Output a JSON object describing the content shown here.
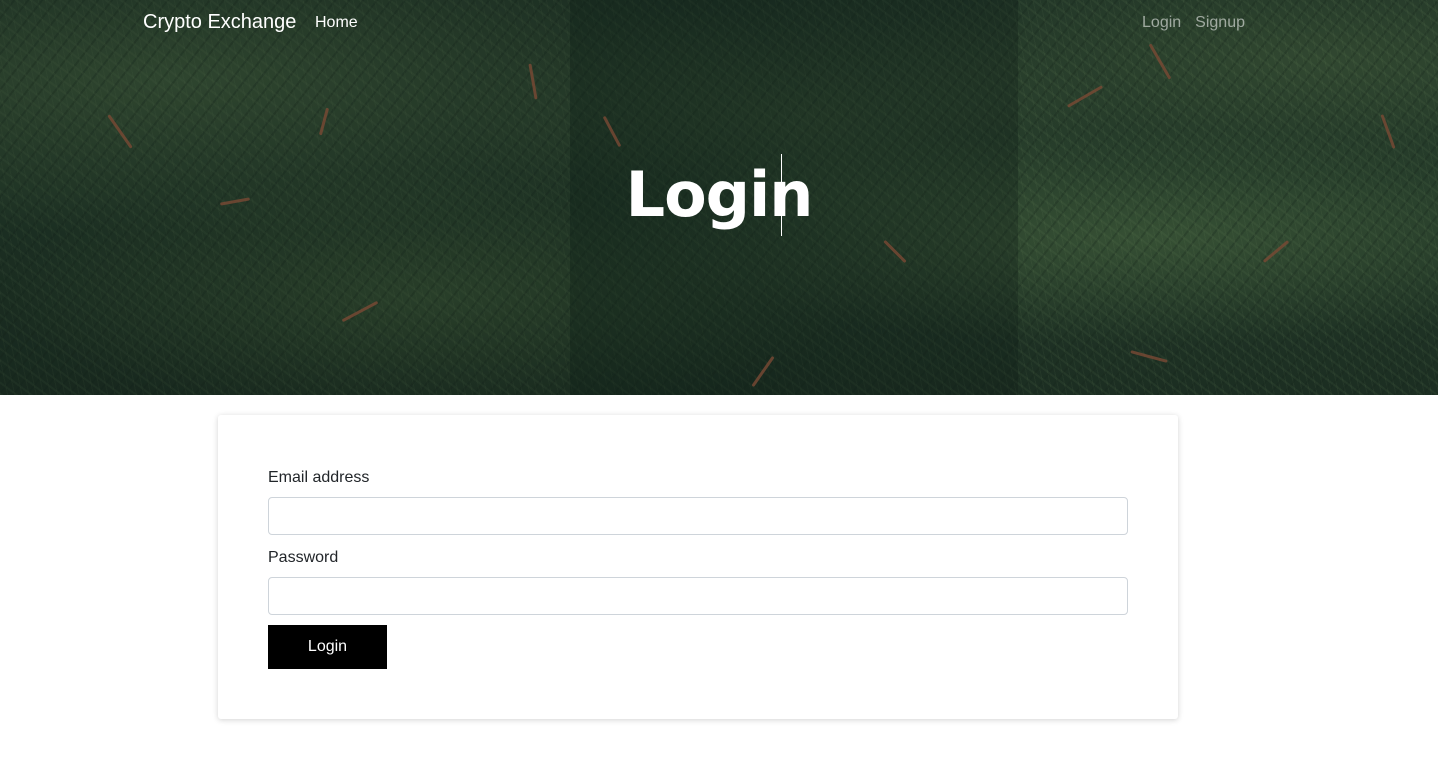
{
  "nav": {
    "brand": "Crypto Exchange",
    "home": "Home",
    "login": "Login",
    "signup": "Signup"
  },
  "hero": {
    "title": "Login"
  },
  "form": {
    "email_label": "Email address",
    "email_value": "",
    "password_label": "Password",
    "password_value": "",
    "submit_label": "Login"
  },
  "colors": {
    "button_bg": "#000000",
    "nav_link_muted": "rgba(255,255,255,0.55)",
    "hero_bg": "#1f3326"
  }
}
